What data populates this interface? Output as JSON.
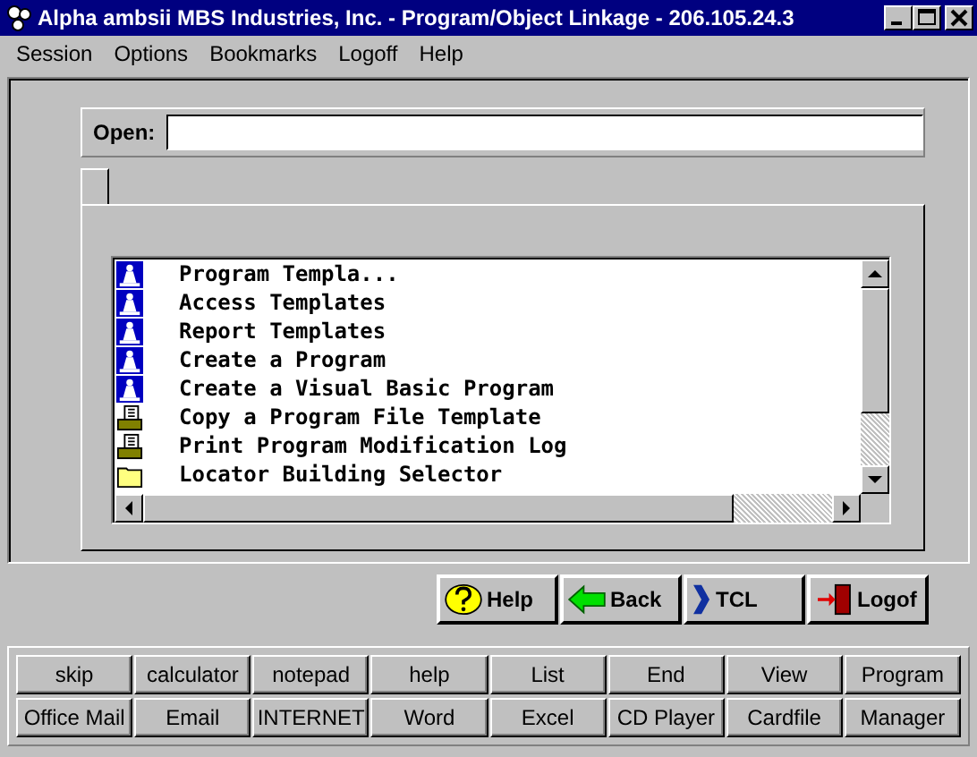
{
  "window": {
    "title": "Alpha ambsii MBS Industries, Inc. - Program/Object Linkage - 206.105.24.3"
  },
  "menu": [
    "Session",
    "Options",
    "Bookmarks",
    "Logoff",
    "Help"
  ],
  "open_field": {
    "label": "Open:"
  },
  "list": [
    {
      "kind": "program",
      "label": "Program Templa..."
    },
    {
      "kind": "program",
      "label": "Access Templates"
    },
    {
      "kind": "program",
      "label": "Report Templates"
    },
    {
      "kind": "program",
      "label": "Create a Program"
    },
    {
      "kind": "program",
      "label": "Create a Visual Basic Program"
    },
    {
      "kind": "file",
      "label": "Copy a Program File Template"
    },
    {
      "kind": "file",
      "label": "Print Program Modification Log"
    },
    {
      "kind": "folder",
      "label": "Locator Building Selector"
    }
  ],
  "toolbar": [
    {
      "kind": "help",
      "label": "Help"
    },
    {
      "kind": "back",
      "label": "Back"
    },
    {
      "kind": "tcl",
      "label": "TCL"
    },
    {
      "kind": "logoff",
      "label": "Logof"
    }
  ],
  "shortcuts": [
    [
      "skip",
      "calculator",
      "notepad",
      "help",
      "List",
      "End",
      "View",
      "Program"
    ],
    [
      "Office Mail",
      "Email",
      "INTERNET",
      "Word",
      "Excel",
      "CD Player",
      "Cardfile",
      "Manager"
    ]
  ]
}
